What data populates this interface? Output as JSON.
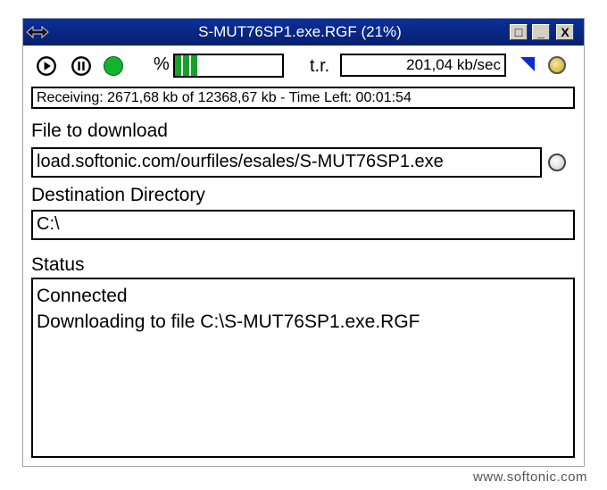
{
  "window": {
    "title": "S-MUT76SP1.exe.RGF (21%)",
    "buttons": {
      "restore": "□",
      "minimize": "_",
      "close": "X"
    }
  },
  "toolbar": {
    "percent_label": "%",
    "progress": 0.21,
    "rate_label": "t.r.",
    "rate_value": "201,04 kb/sec"
  },
  "status_line": "Receiving: 2671,68 kb of 12368,67 kb - Time Left: 00:01:54",
  "file": {
    "label": "File to download",
    "value": "load.softonic.com/ourfiles/esales/S-MUT76SP1.exe"
  },
  "destination": {
    "label": "Destination Directory",
    "value": "C:\\"
  },
  "status": {
    "label": "Status",
    "lines": [
      "Connected",
      "Downloading to file C:\\S-MUT76SP1.exe.RGF"
    ]
  },
  "footer": "www.softonic.com",
  "colors": {
    "titlebar": "#0a2f9a",
    "progress": "#14a327",
    "green_light": "#12b331",
    "triangle": "#0b2bd6"
  },
  "icons": {
    "app": "arrows-icon",
    "play": "play-icon",
    "pause": "pause-icon",
    "connected": "green-light-icon",
    "options": "blue-triangle-icon",
    "schedule": "gold-circle-icon",
    "browse": "browse-circle-icon"
  }
}
